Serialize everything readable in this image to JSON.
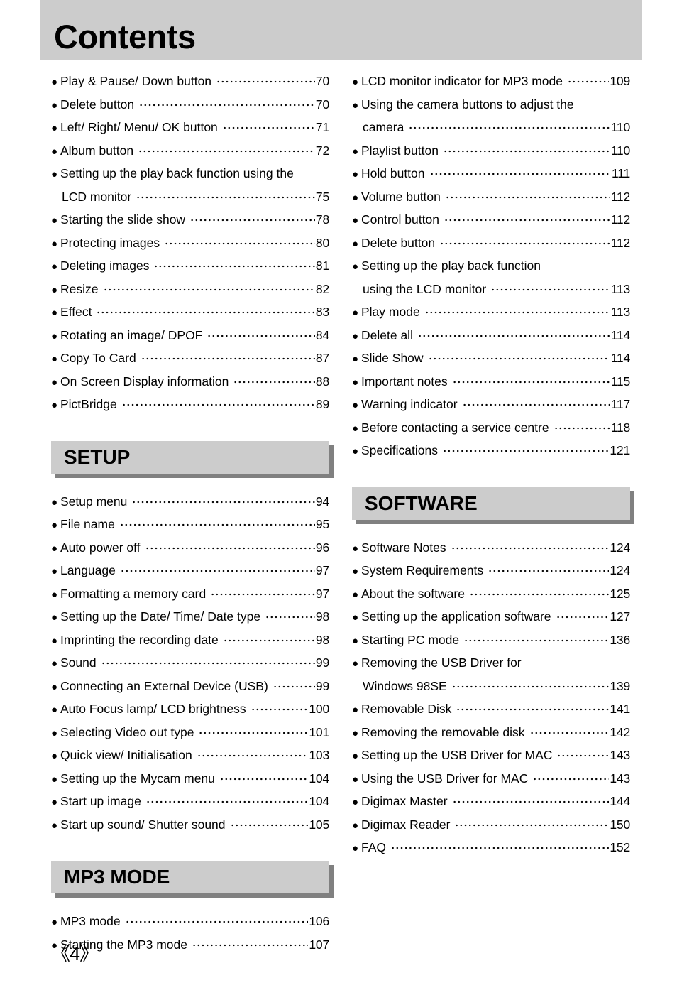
{
  "header": {
    "title": "Contents"
  },
  "colors": {
    "band_face": "#cccccc",
    "band_shadow": "#808080",
    "header_bg": "#cccccc",
    "text": "#000000"
  },
  "footer": {
    "page_folio": "《4》"
  },
  "left_column": {
    "sections": [
      {
        "band": null,
        "entries": [
          {
            "label": "Play & Pause/ Down button",
            "page": "70",
            "continued": false
          },
          {
            "label": "Delete button",
            "page": "70",
            "continued": false
          },
          {
            "label": "Left/ Right/ Menu/ OK button",
            "page": "71",
            "continued": false
          },
          {
            "label": "Album button",
            "page": "72",
            "continued": false
          },
          {
            "label": "Setting up the play back function using the",
            "page": "",
            "continued": false
          },
          {
            "label": "LCD monitor",
            "page": "75",
            "continued": true
          },
          {
            "label": "Starting the slide show",
            "page": "78",
            "continued": false
          },
          {
            "label": "Protecting images",
            "page": "80",
            "continued": false
          },
          {
            "label": "Deleting images",
            "page": "81",
            "continued": false
          },
          {
            "label": "Resize",
            "page": "82",
            "continued": false
          },
          {
            "label": "Effect",
            "page": "83",
            "continued": false
          },
          {
            "label": "Rotating an image/ DPOF",
            "page": "84",
            "continued": false
          },
          {
            "label": "Copy To Card",
            "page": "87",
            "continued": false
          },
          {
            "label": "On Screen Display information",
            "page": "88",
            "continued": false
          },
          {
            "label": "PictBridge",
            "page": "89",
            "continued": false
          }
        ]
      },
      {
        "band": "SETUP",
        "entries": [
          {
            "label": "Setup menu",
            "page": "94",
            "continued": false
          },
          {
            "label": "File name",
            "page": "95",
            "continued": false
          },
          {
            "label": "Auto power off",
            "page": "96",
            "continued": false
          },
          {
            "label": "Language",
            "page": "97",
            "continued": false
          },
          {
            "label": "Formatting a memory card",
            "page": "97",
            "continued": false
          },
          {
            "label": "Setting up the Date/ Time/ Date type",
            "page": "98",
            "continued": false
          },
          {
            "label": "Imprinting the recording date",
            "page": "98",
            "continued": false
          },
          {
            "label": "Sound",
            "page": "99",
            "continued": false
          },
          {
            "label": "Connecting an External Device (USB)",
            "page": "99",
            "continued": false
          },
          {
            "label": "Auto Focus lamp/ LCD brightness",
            "page": "100",
            "continued": false
          },
          {
            "label": "Selecting Video out type",
            "page": "101",
            "continued": false
          },
          {
            "label": "Quick view/ Initialisation",
            "page": "103",
            "continued": false
          },
          {
            "label": "Setting up the Mycam menu",
            "page": "104",
            "continued": false
          },
          {
            "label": "Start up image",
            "page": "104",
            "continued": false
          },
          {
            "label": "Start up sound/ Shutter sound",
            "page": "105",
            "continued": false
          }
        ]
      },
      {
        "band": "MP3 MODE",
        "entries": [
          {
            "label": "MP3 mode",
            "page": "106",
            "continued": false
          },
          {
            "label": "Starting the MP3 mode",
            "page": "107",
            "continued": false
          }
        ]
      }
    ]
  },
  "right_column": {
    "sections": [
      {
        "band": null,
        "entries": [
          {
            "label": "LCD monitor indicator for MP3 mode",
            "page": "109",
            "continued": false
          },
          {
            "label": "Using the camera buttons to adjust the",
            "page": "",
            "continued": false
          },
          {
            "label": "camera",
            "page": "110",
            "continued": true
          },
          {
            "label": "Playlist button",
            "page": "110",
            "continued": false
          },
          {
            "label": "Hold button",
            "page": "111",
            "continued": false
          },
          {
            "label": "Volume button",
            "page": "112",
            "continued": false
          },
          {
            "label": "Control button",
            "page": "112",
            "continued": false
          },
          {
            "label": "Delete button",
            "page": "112",
            "continued": false
          },
          {
            "label": "Setting up the play back function",
            "page": "",
            "continued": false
          },
          {
            "label": "using the LCD monitor",
            "page": "113",
            "continued": true
          },
          {
            "label": "Play mode",
            "page": "113",
            "continued": false
          },
          {
            "label": "Delete all",
            "page": "114",
            "continued": false
          },
          {
            "label": "Slide Show",
            "page": "114",
            "continued": false
          },
          {
            "label": "Important notes",
            "page": "115",
            "continued": false
          },
          {
            "label": "Warning indicator",
            "page": "117",
            "continued": false
          },
          {
            "label": "Before contacting a service centre",
            "page": "118",
            "continued": false
          },
          {
            "label": "Specifications",
            "page": "121",
            "continued": false
          }
        ]
      },
      {
        "band": "SOFTWARE",
        "entries": [
          {
            "label": "Software Notes",
            "page": "124",
            "continued": false
          },
          {
            "label": "System Requirements",
            "page": "124",
            "continued": false
          },
          {
            "label": "About the software",
            "page": "125",
            "continued": false
          },
          {
            "label": "Setting up the application software",
            "page": "127",
            "continued": false
          },
          {
            "label": "Starting PC mode",
            "page": "136",
            "continued": false
          },
          {
            "label": "Removing the USB Driver for",
            "page": "",
            "continued": false
          },
          {
            "label": "Windows 98SE",
            "page": "139",
            "continued": true
          },
          {
            "label": "Removable Disk",
            "page": "141",
            "continued": false
          },
          {
            "label": "Removing the removable disk",
            "page": "142",
            "continued": false
          },
          {
            "label": "Setting up the USB Driver for MAC",
            "page": "143",
            "continued": false
          },
          {
            "label": "Using the USB Driver for MAC",
            "page": "143",
            "continued": false
          },
          {
            "label": "Digimax Master",
            "page": "144",
            "continued": false
          },
          {
            "label": "Digimax Reader",
            "page": "150",
            "continued": false
          },
          {
            "label": "FAQ",
            "page": "152",
            "continued": false
          }
        ]
      }
    ]
  }
}
